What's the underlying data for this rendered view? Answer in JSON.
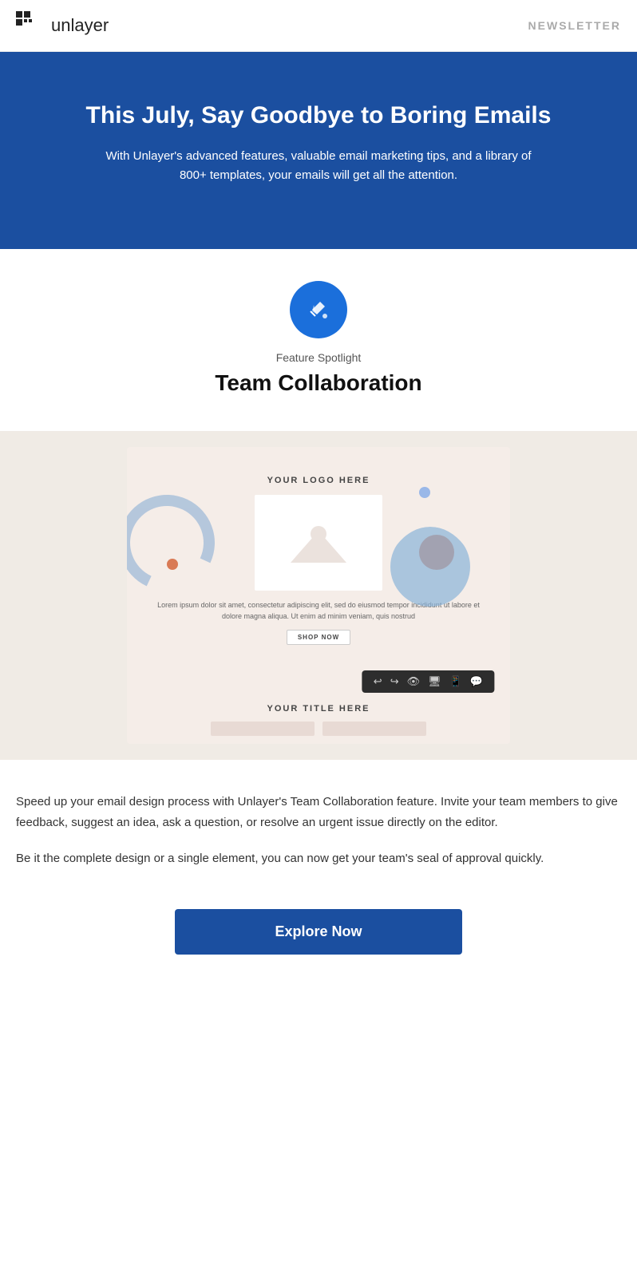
{
  "header": {
    "logo_text": "unlayer",
    "newsletter_label": "NEWSLETTER"
  },
  "hero": {
    "title": "This July, Say Goodbye to Boring Emails",
    "subtitle": "With Unlayer's advanced features, valuable email marketing tips, and a library of 800+ templates, your emails will get all the attention."
  },
  "feature": {
    "spotlight_label": "Feature Spotlight",
    "title": "Team Collaboration"
  },
  "template_preview": {
    "logo_text": "YOUR LOGO HERE",
    "body_text": "Lorem ipsum dolor sit amet, consectetur adipiscing elit, sed do eiusmod tempor incididunt ut labore et dolore magna aliqua. Ut enim ad minim veniam, quis nostrud",
    "shop_btn_label": "SHOP NOW",
    "title_area": "YOUR TITLE HERE",
    "toolbar_icons": [
      "↩",
      "↪",
      "👁",
      "🖥",
      "📱",
      "💬"
    ]
  },
  "body": {
    "paragraph1": "Speed up your email design process with Unlayer's Team Collaboration feature. Invite your team members to give feedback, suggest an idea, ask a question, or resolve an urgent issue directly on the editor.",
    "paragraph2": "Be it the complete design or a single element, you can now get your team's seal of approval quickly."
  },
  "cta": {
    "button_label": "Explore Now"
  }
}
